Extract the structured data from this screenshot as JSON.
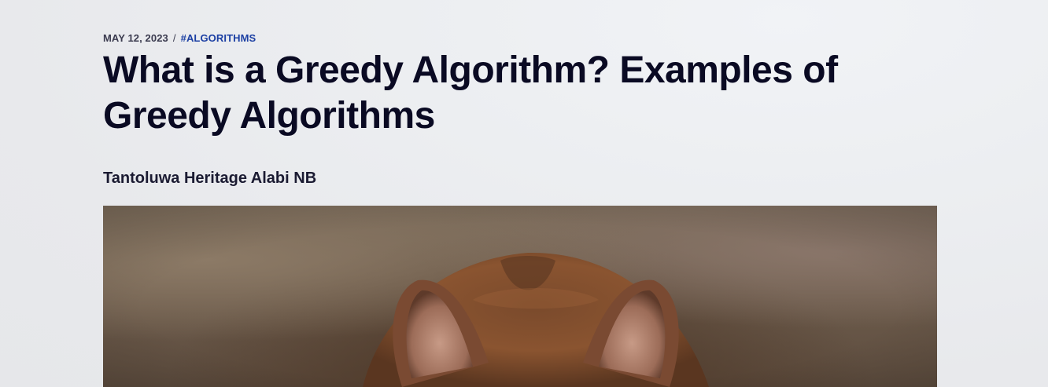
{
  "meta": {
    "date": "MAY 12, 2023",
    "separator": "/",
    "tag": "#ALGORITHMS"
  },
  "title": "What is a Greedy Algorithm? Examples of Greedy Algorithms",
  "author": "Tantoluwa Heritage Alabi NB",
  "colors": {
    "title": "#0a0a23",
    "tag": "#1b3fa3",
    "background": "#eceef1"
  },
  "feature_image": {
    "subject": "mouse-photo"
  }
}
